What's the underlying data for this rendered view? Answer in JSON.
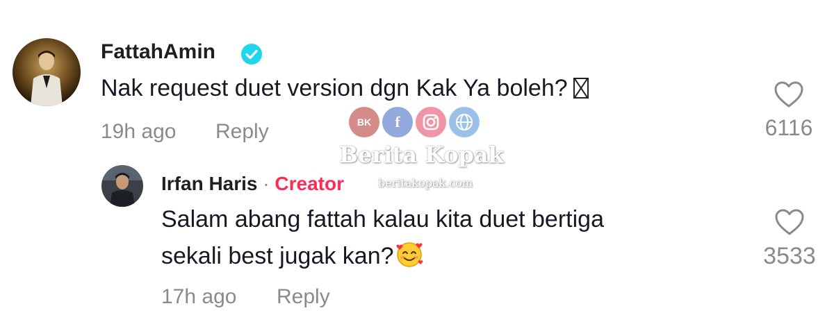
{
  "watermark": {
    "brand": "Berita Kopak",
    "site": "beritakopak.com"
  },
  "comments": [
    {
      "username": "FattahAmin",
      "verified": true,
      "text": "Nak request duet version dgn Kak Ya boleh?",
      "time": "19h ago",
      "reply_label": "Reply",
      "likes": "6116"
    }
  ],
  "replies": [
    {
      "username": "Irfan Haris",
      "separator": "·",
      "badge": "Creator",
      "text_line1": "Salam abang fattah kalau kita duet bertiga",
      "text_line2": "sekali best jugak kan?",
      "time": "17h ago",
      "reply_label": "Reply",
      "likes": "3533"
    }
  ],
  "colors": {
    "creator_badge": "#fe2c55",
    "verified_badge": "#20d5ec",
    "muted_text": "#8a8a8a"
  },
  "icons": {
    "like": "heart-outline-icon",
    "verified": "verified-check-icon",
    "unsupported_emoji": "missing-glyph-box",
    "reply_emoji": "smiling-face-with-hearts"
  }
}
